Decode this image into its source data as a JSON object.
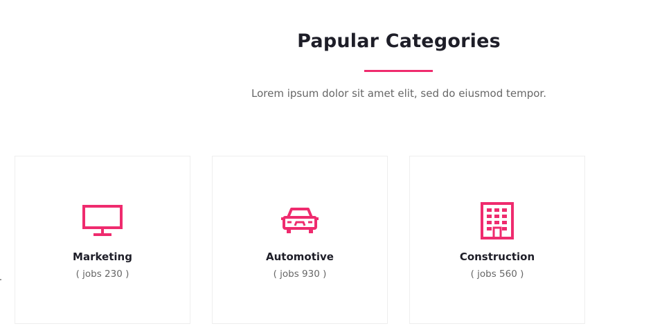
{
  "section": {
    "title": "Papular Categories",
    "subtitle": "Lorem ipsum dolor sit amet elit, sed do eiusmod tempor."
  },
  "colors": {
    "accent": "#ef2b6e",
    "heading": "#1e1e28",
    "body_text": "#666666",
    "card_border": "#eeeeee"
  },
  "categories": [
    {
      "name": "Marketing",
      "count": "( jobs 230 )",
      "icon": "monitor-icon"
    },
    {
      "name": "Automotive",
      "count": "( jobs 930 )",
      "icon": "car-icon"
    },
    {
      "name": "Construction",
      "count": "( jobs 560 )",
      "icon": "building-icon"
    }
  ]
}
